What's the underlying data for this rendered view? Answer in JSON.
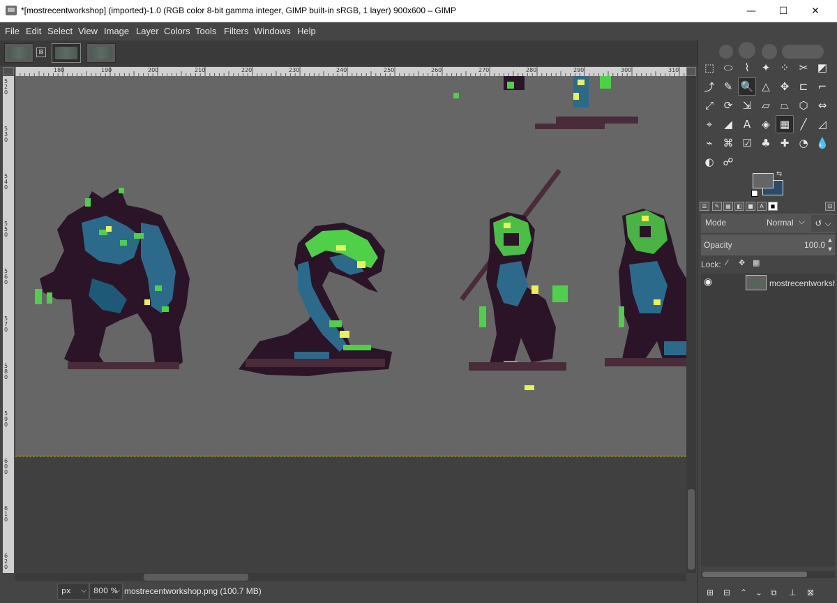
{
  "window": {
    "title": "*[mostrecentworkshop] (imported)-1.0 (RGB color 8-bit gamma integer, GIMP built-in sRGB, 1 layer) 900x600 – GIMP",
    "minimize": "—",
    "maximize": "☐",
    "close": "✕"
  },
  "menu": [
    "File",
    "Edit",
    "Select",
    "View",
    "Image",
    "Layer",
    "Colors",
    "Tools",
    "Filters",
    "Windows",
    "Help"
  ],
  "tabs": {
    "close_glyph": "⊠"
  },
  "ruler": {
    "h_labels": [
      "180",
      "190",
      "200",
      "210",
      "220",
      "230",
      "240",
      "250",
      "260",
      "270",
      "280",
      "290",
      "300",
      "310"
    ],
    "v_labels": [
      "520",
      "530",
      "540",
      "550",
      "560",
      "570",
      "580",
      "590",
      "600",
      "610",
      "620"
    ]
  },
  "statusbar": {
    "unit": "px",
    "zoom": "800 %",
    "file_info": "mostrecentworkshop.png (100.7 MB)"
  },
  "toolbox": {
    "tools": [
      {
        "name": "rect-select-tool",
        "glyph": "⬚"
      },
      {
        "name": "ellipse-select-tool",
        "glyph": "⬭"
      },
      {
        "name": "free-select-tool",
        "glyph": "⌇"
      },
      {
        "name": "fuzzy-select-tool",
        "glyph": "✦"
      },
      {
        "name": "select-by-color-tool",
        "glyph": "⁘"
      },
      {
        "name": "scissors-select-tool",
        "glyph": "✂"
      },
      {
        "name": "foreground-select-tool",
        "glyph": "◩"
      },
      {
        "name": "paths-tool",
        "glyph": "⤴"
      },
      {
        "name": "color-picker-tool",
        "glyph": "✎"
      },
      {
        "name": "zoom-tool",
        "glyph": "🔍"
      },
      {
        "name": "measure-tool",
        "glyph": "△"
      },
      {
        "name": "move-tool",
        "glyph": "✥"
      },
      {
        "name": "align-tool",
        "glyph": "⊏"
      },
      {
        "name": "crop-tool",
        "glyph": "⌐"
      },
      {
        "name": "unified-transform-tool",
        "glyph": "⤢"
      },
      {
        "name": "rotate-tool",
        "glyph": "⟳"
      },
      {
        "name": "scale-tool",
        "glyph": "⇲"
      },
      {
        "name": "shear-tool",
        "glyph": "▱"
      },
      {
        "name": "perspective-tool",
        "glyph": "⏢"
      },
      {
        "name": "3d-transform-tool",
        "glyph": "⬡"
      },
      {
        "name": "flip-tool",
        "glyph": "⇔"
      },
      {
        "name": "cage-transform-tool",
        "glyph": "⌖"
      },
      {
        "name": "warp-transform-tool",
        "glyph": "◢"
      },
      {
        "name": "text-tool",
        "glyph": "A"
      },
      {
        "name": "bucket-fill-tool",
        "glyph": "◈"
      },
      {
        "name": "gradient-tool",
        "glyph": "▦"
      },
      {
        "name": "paintbrush-tool",
        "glyph": "╱"
      },
      {
        "name": "eraser-tool",
        "glyph": "◿"
      },
      {
        "name": "airbrush-tool",
        "glyph": "⌁"
      },
      {
        "name": "ink-tool",
        "glyph": "⌘"
      },
      {
        "name": "mypaint-brush-tool",
        "glyph": "☑"
      },
      {
        "name": "clone-tool",
        "glyph": "♣"
      },
      {
        "name": "heal-tool",
        "glyph": "✚"
      },
      {
        "name": "smudge-tool",
        "glyph": "◔"
      },
      {
        "name": "blur-tool",
        "glyph": "💧"
      },
      {
        "name": "dodge-burn-tool",
        "glyph": "◐"
      },
      {
        "name": "smudge-alt-tool",
        "glyph": "☍"
      }
    ]
  },
  "fgbg": {
    "fg_color": "#656565",
    "bg_color": "#2d4a66",
    "swap": "⇆"
  },
  "dock_tabs": [
    "☰",
    "✎",
    "▦",
    "◧",
    "■",
    "A",
    "◼"
  ],
  "layers": {
    "mode_label": "Mode",
    "mode_value": "Normal",
    "mode_chevron": "⌵",
    "reset_glyph": "↺ ⌵",
    "opacity_label": "Opacity",
    "opacity_value": "100.0",
    "lock_label": "Lock:",
    "lock_icons": [
      "⁄",
      "✥",
      "▦"
    ],
    "layer_name": "mostrecentworkshop",
    "eye": "◉",
    "actions": [
      "⊞",
      "⊟",
      "⌃",
      "⌄",
      "⧉",
      "⊥",
      "⊠"
    ]
  }
}
